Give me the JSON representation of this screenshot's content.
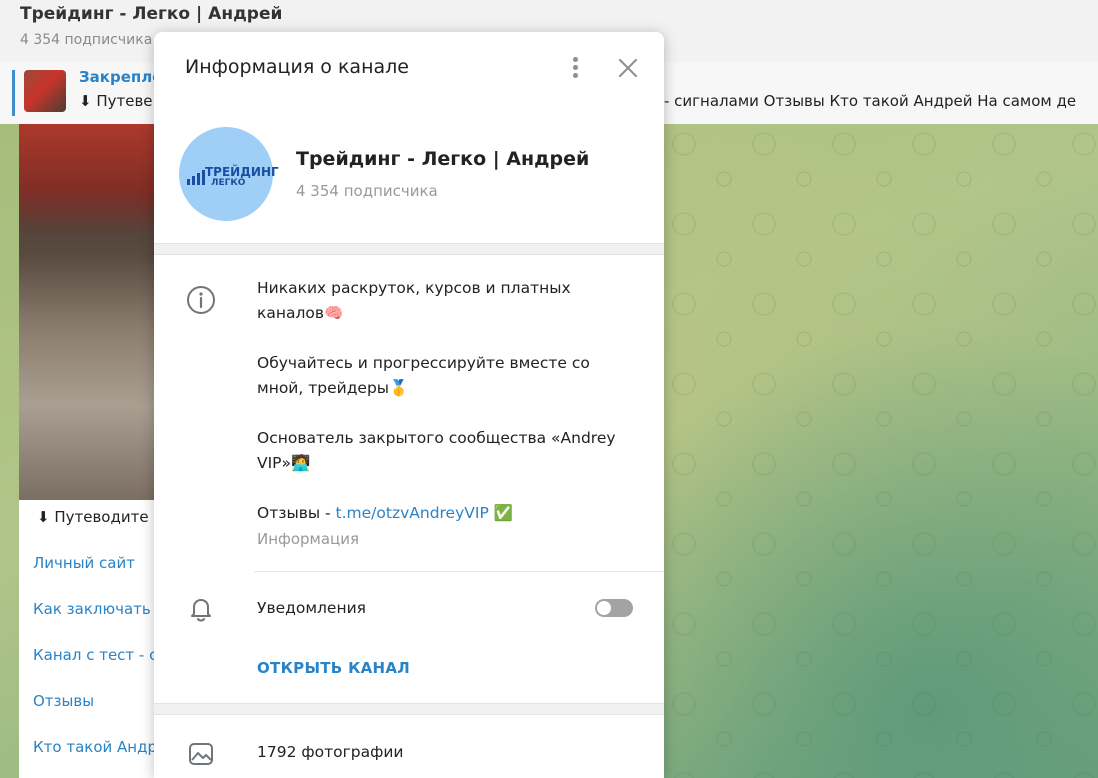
{
  "chat": {
    "title": "Трейдинг - Легко | Андрей",
    "subscribers": "4 354 подписчика",
    "pinned": {
      "title": "Закрепле",
      "text_start": "⬇ Путеве",
      "text_end": "- сигналами  Отзывы  Кто такой Андрей  На самом де"
    },
    "message": {
      "header": "⬇ Путеводите",
      "links": [
        "Личный сайт",
        "Как заключать",
        "Канал с тест - с",
        "Отзывы",
        "Кто такой Андр"
      ]
    }
  },
  "modal": {
    "title": "Информация о канале",
    "channel_name": "Трейдинг - Легко | Андрей",
    "subscribers": "4 354 подписчика",
    "logo_line1": "ТРЕЙДИНГ",
    "logo_line2": "ЛЕГКО",
    "description": {
      "p1": "Никаких раскруток, курсов и платных каналов🧠",
      "p2": "Обучайтесь и прогрессируйте вместе со мной, трейдеры🥇",
      "p3": "Основатель закрытого сообщества «Andrey VIP»🧑‍💻",
      "reviews_prefix": "Отзывы - ",
      "reviews_link": "t.me/otzvAndreyVIP",
      "reviews_suffix": " ✅"
    },
    "info_caption": "Информация",
    "notifications_label": "Уведомления",
    "notifications_enabled": false,
    "open_channel_label": "ОТКРЫТЬ КАНАЛ",
    "photos_label": "1792 фотографии"
  },
  "colors": {
    "accent": "#2a83c6",
    "muted_text": "#999999",
    "toggle_off": "#a3a3a3",
    "avatar_bg": "#9fcff7"
  },
  "icons": [
    "more-vertical-icon",
    "close-icon",
    "info-icon",
    "bell-icon",
    "photo-icon"
  ]
}
